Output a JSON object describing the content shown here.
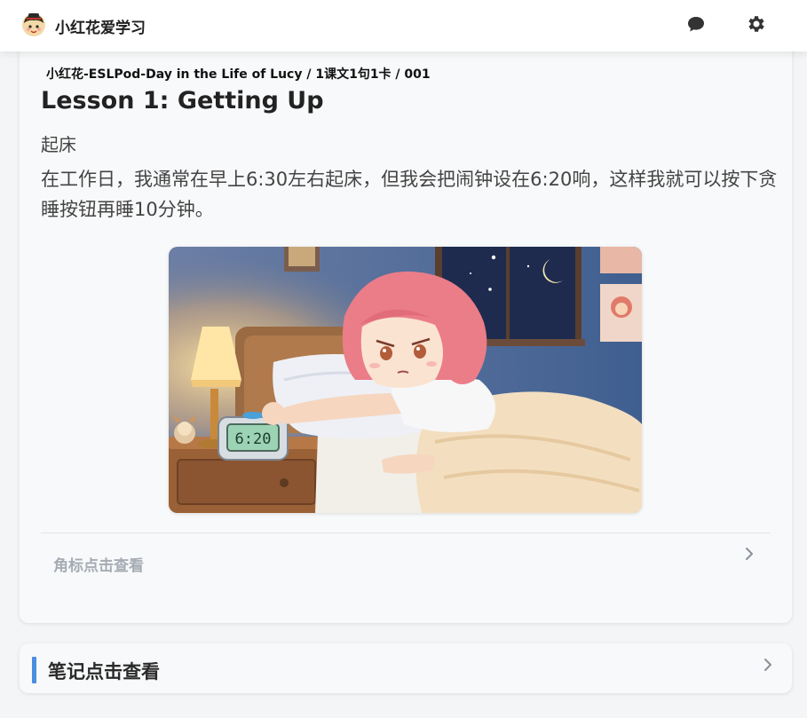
{
  "header": {
    "app_title": "小红花爱学习",
    "icons": {
      "logo": "mascot-avatar-icon",
      "chat": "chat-bubble-icon",
      "settings": "gear-icon"
    }
  },
  "lesson": {
    "breadcrumb": "小红花-ESLPod-Day in the Life of Lucy / 1课文1句1卡 / 001",
    "title": "Lesson 1: Getting Up",
    "subtitle": "起床",
    "sentence": "在工作日，我通常在早上6:30左右起床，但我会把闹钟设在6:20响，这样我就可以按下贪睡按钮再睡10分钟。",
    "illustration": {
      "description_icon": "girl-pressing-alarm-clock-illustration",
      "clock_display": "6:20"
    },
    "corner_link_label": "角标点击查看"
  },
  "notes": {
    "label": "笔记点击查看"
  },
  "colors": {
    "accent": "#4a8ee0",
    "muted_text": "#a6acb4",
    "card_bg": "#f8f9fa"
  }
}
